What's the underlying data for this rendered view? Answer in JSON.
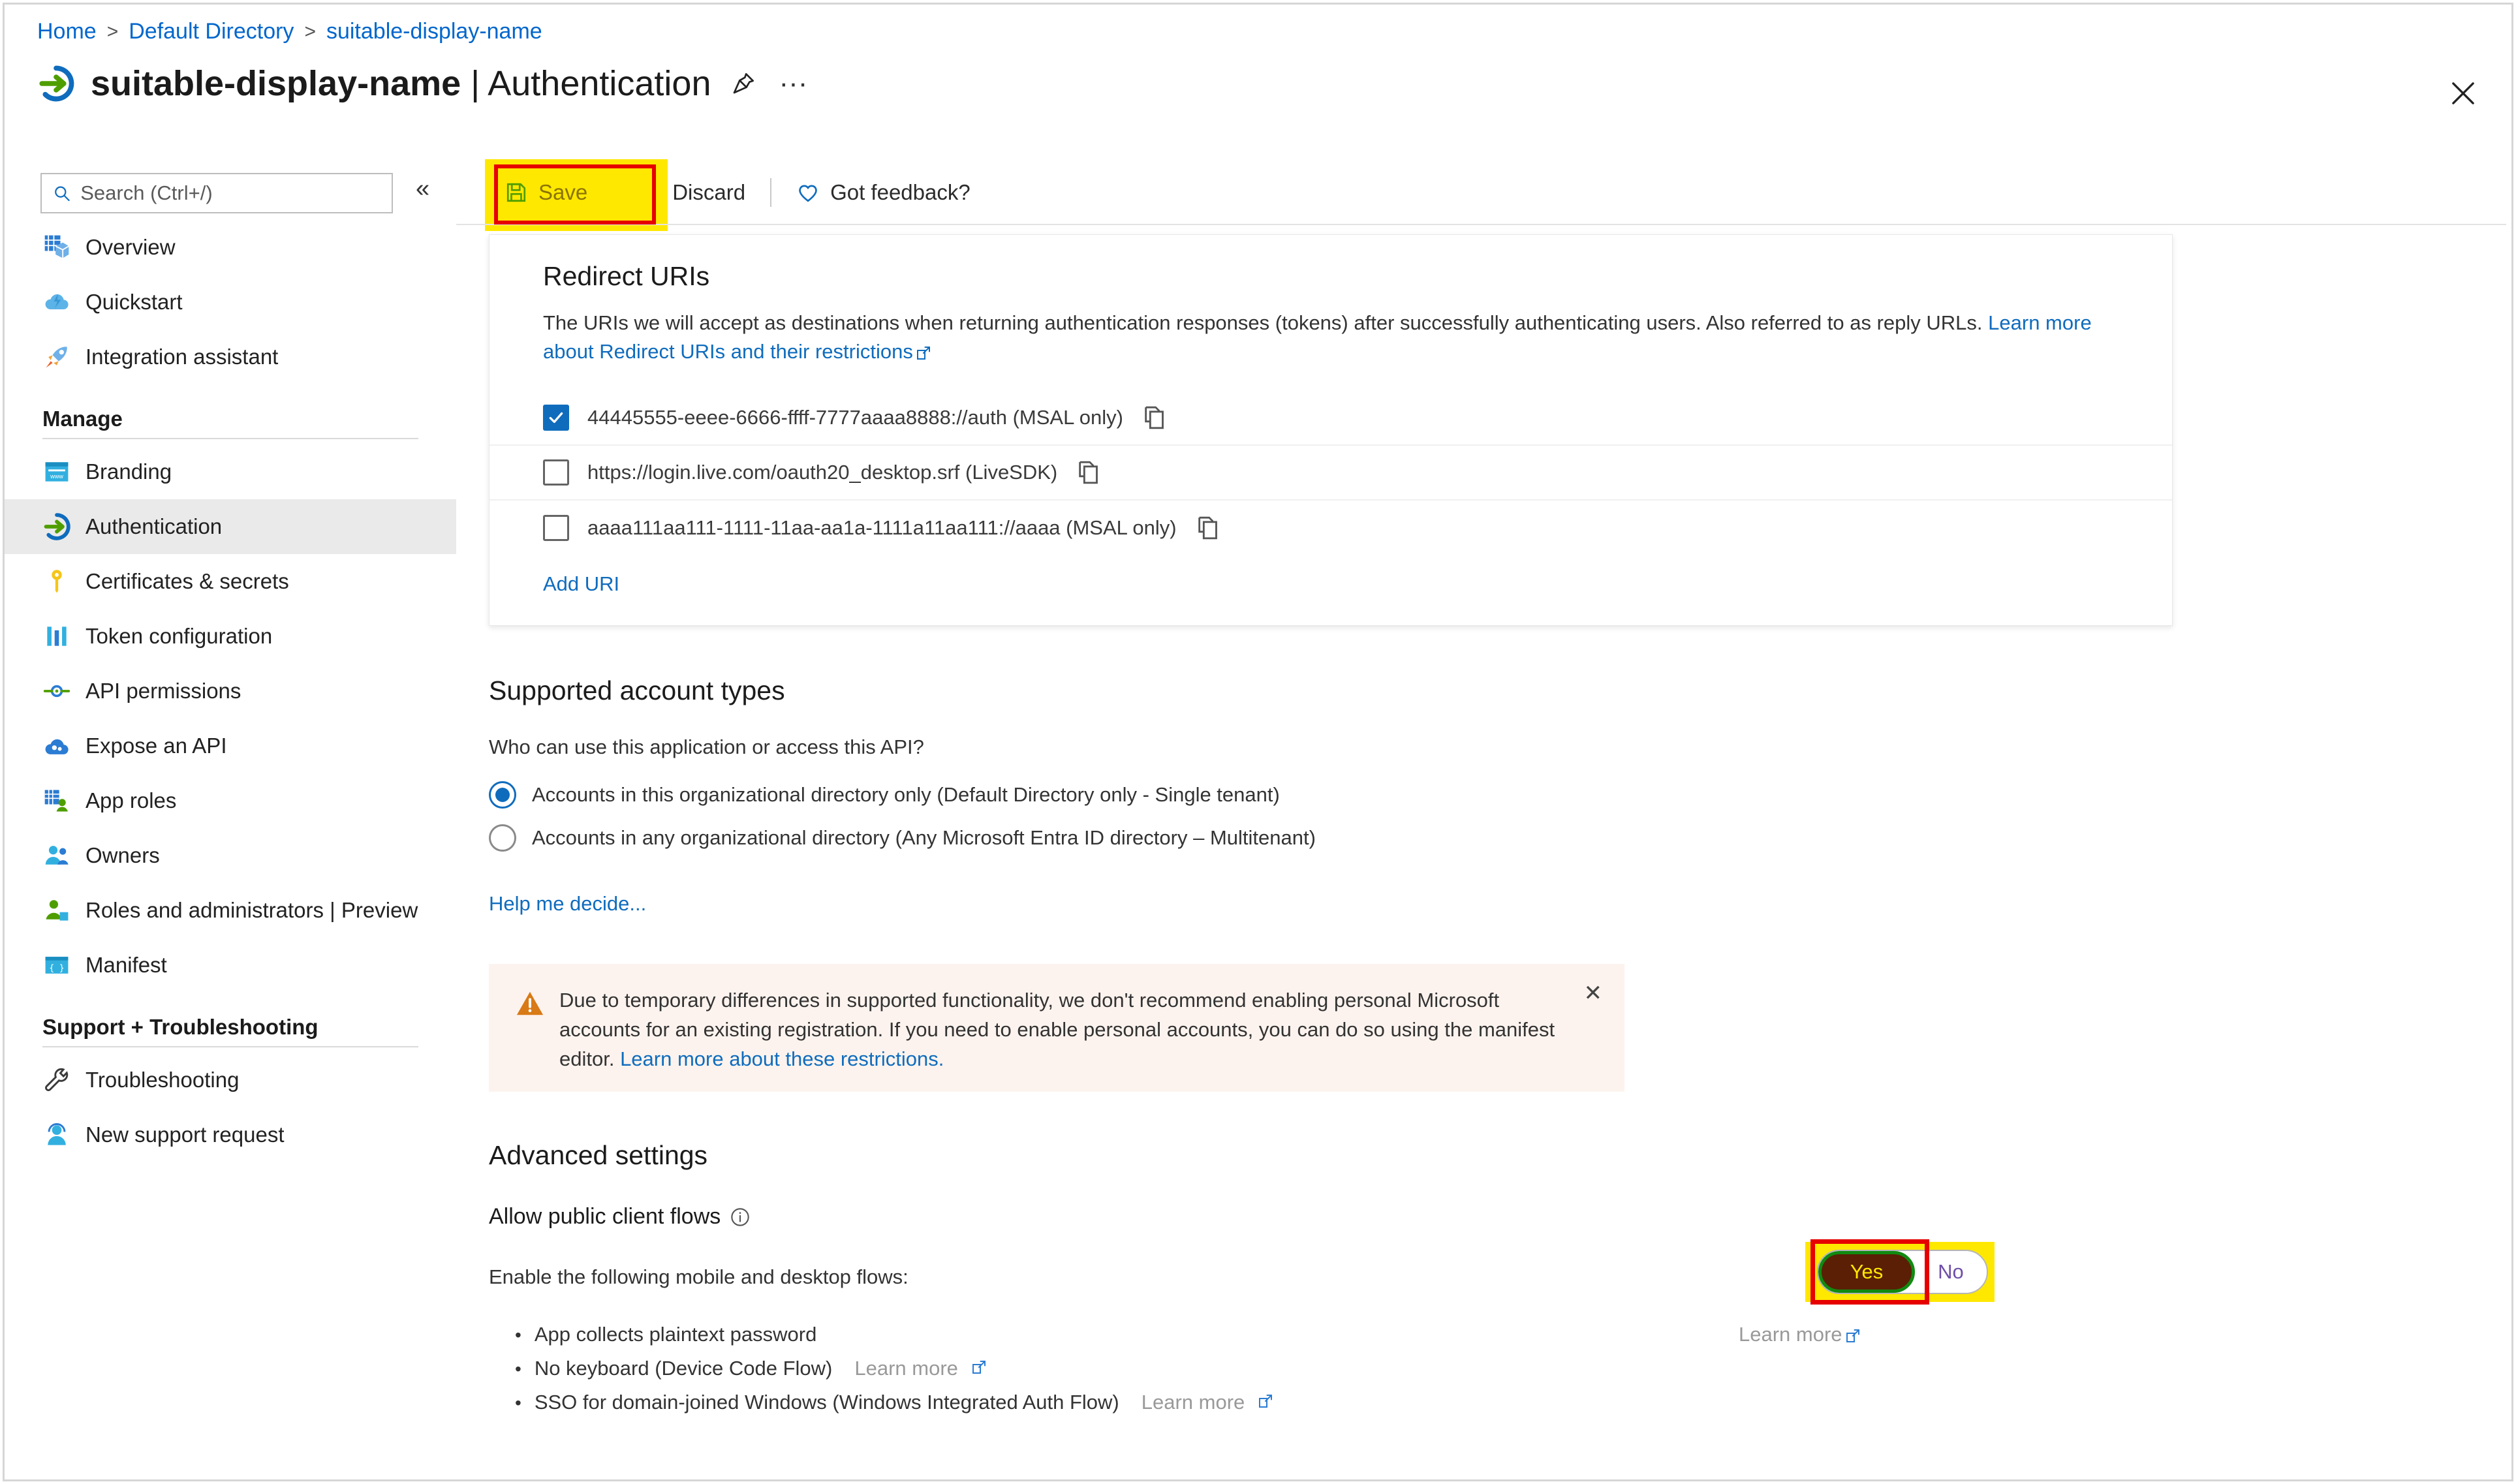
{
  "breadcrumb": {
    "items": [
      "Home",
      "Default Directory",
      "suitable-display-name"
    ],
    "separator": ">"
  },
  "header": {
    "app_name": "suitable-display-name",
    "separator": " | ",
    "section": "Authentication",
    "pin_icon": "pin-icon",
    "more_icon": "ellipsis-icon",
    "close_icon": "close-icon"
  },
  "search": {
    "placeholder": "Search (Ctrl+/)",
    "value": "",
    "icon": "search-icon"
  },
  "collapse": {
    "glyph": "«"
  },
  "sidebar": {
    "items": [
      {
        "label": "Overview",
        "icon": "grid-cube-icon"
      },
      {
        "label": "Quickstart",
        "icon": "cloud-lightning-icon"
      },
      {
        "label": "Integration assistant",
        "icon": "rocket-icon"
      }
    ],
    "groups": [
      {
        "title": "Manage",
        "items": [
          {
            "label": "Branding",
            "icon": "browser-window-icon"
          },
          {
            "label": "Authentication",
            "icon": "authentication-arrow-icon",
            "active": true
          },
          {
            "label": "Certificates & secrets",
            "icon": "key-icon"
          },
          {
            "label": "Token configuration",
            "icon": "bar-columns-icon"
          },
          {
            "label": "API permissions",
            "icon": "api-plug-icon"
          },
          {
            "label": "Expose an API",
            "icon": "cloud-gear-icon"
          },
          {
            "label": "App roles",
            "icon": "grid-person-icon"
          },
          {
            "label": "Owners",
            "icon": "people-icon"
          },
          {
            "label": "Roles and administrators | Preview",
            "icon": "person-role-icon"
          },
          {
            "label": "Manifest",
            "icon": "braces-window-icon"
          }
        ]
      },
      {
        "title": "Support + Troubleshooting",
        "items": [
          {
            "label": "Troubleshooting",
            "icon": "wrench-icon"
          },
          {
            "label": "New support request",
            "icon": "headset-person-icon"
          }
        ]
      }
    ]
  },
  "toolbar": {
    "save_label": "Save",
    "save_icon": "save-disk-icon",
    "discard_label": "Discard",
    "discard_icon": "x-cross-icon",
    "feedback_label": "Got feedback?",
    "feedback_icon": "heart-icon"
  },
  "redirect_uris": {
    "heading": "Redirect URIs",
    "description": "The URIs we will accept as destinations when returning authentication responses (tokens) after successfully authenticating users. Also referred to as reply URLs.",
    "learn_more": "Learn more about Redirect URIs and their restrictions",
    "rows": [
      {
        "value": "44445555-eeee-6666-ffff-7777aaaa8888://auth (MSAL only)",
        "checked": true,
        "copy_icon": "copy-icon"
      },
      {
        "value": "https://login.live.com/oauth20_desktop.srf (LiveSDK)",
        "checked": false,
        "copy_icon": "copy-icon"
      },
      {
        "value": "aaaa111aa111-1111-11aa-aa1a-1111a11aa111://aaaa (MSAL only)",
        "checked": false,
        "copy_icon": "copy-icon"
      }
    ],
    "add_label": "Add URI"
  },
  "supported_account_types": {
    "heading": "Supported account types",
    "question": "Who can use this application or access this API?",
    "options": [
      {
        "label": "Accounts in this organizational directory only (Default Directory only - Single tenant)",
        "selected": true
      },
      {
        "label": "Accounts in any organizational directory (Any Microsoft Entra ID directory – Multitenant)",
        "selected": false
      }
    ],
    "help_link": "Help me decide..."
  },
  "warning": {
    "icon": "warning-triangle-icon",
    "text": "Due to temporary differences in supported functionality, we don't recommend enabling personal Microsoft accounts for an existing registration. If you need to enable personal accounts, you can do so using the manifest editor. ",
    "link": "Learn more about these restrictions.",
    "close_icon": "close-icon"
  },
  "advanced_settings": {
    "heading": "Advanced settings",
    "subheading": "Allow public client flows",
    "info_icon": "info-circle-icon",
    "enable_label": "Enable the following mobile and desktop flows:",
    "toggle": {
      "yes_label": "Yes",
      "no_label": "No",
      "value": "Yes"
    },
    "flows": [
      {
        "label": "App collects plaintext password",
        "learn_more": "",
        "learn_more_right": "Learn more"
      },
      {
        "label": "No keyboard (Device Code Flow)",
        "learn_more": "Learn more",
        "learn_more_right": ""
      },
      {
        "label": "SSO for domain-joined Windows (Windows Integrated Auth Flow)",
        "learn_more": "Learn more",
        "learn_more_right": ""
      }
    ]
  },
  "colors": {
    "link": "#0f6cbd",
    "breadcrumb_link": "#0066cc",
    "highlight_yellow": "#ffe800",
    "highlight_red": "#e60000",
    "active_nav_bg": "#eaeaea",
    "warning_bg": "#fdf3ee",
    "warning_icon": "#d87a16",
    "toggle_yes_bg": "#5a1f05",
    "toggle_yes_text": "#ffe800",
    "toggle_yes_border": "#118a11",
    "toggle_no_text": "#6f4fa8"
  }
}
